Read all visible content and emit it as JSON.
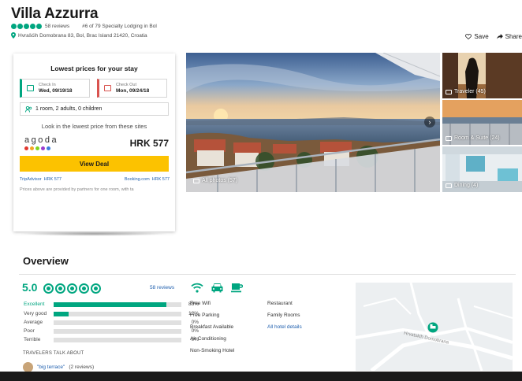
{
  "header": {
    "title": "Villa Azzurra",
    "reviews": "58 reviews",
    "ranking": "#6 of 79 Specialty Lodging in Bol",
    "address": "Hvrašćih Domobrana 83, Bol, Brac Island 21420, Croatia",
    "save_label": "Save",
    "share_label": "Share"
  },
  "pricing": {
    "title": "Lowest prices for your stay",
    "check_in_label": "Check In",
    "check_in_value": "Wed, 09/19/18",
    "check_out_label": "Check Out",
    "check_out_value": "Mon, 09/24/18",
    "guests": "1 room, 2 adults, 0 children",
    "look_text": "Look in the lowest price from these sites",
    "provider": "agoda",
    "price": "HRK 577",
    "deal_label": "View Deal",
    "partners": [
      {
        "name": "TripAdvisor",
        "price": "HRK 577"
      },
      {
        "name": "Booking.com",
        "price": "HRK 577"
      }
    ],
    "disclaimer": "Prices above are provided by partners for one room, with ta"
  },
  "photos": {
    "all_label": "All photos (57)",
    "side": [
      {
        "label": "Traveler (45)"
      },
      {
        "label": "Room & Suite (24)"
      },
      {
        "label": "Dining (4)"
      }
    ]
  },
  "overview": {
    "title": "Overview",
    "score": "5.0",
    "reviews_link": "58 reviews",
    "ratings": [
      {
        "label": "Excellent",
        "pct": "88%",
        "value": 88
      },
      {
        "label": "Very good",
        "pct": "12%",
        "value": 12
      },
      {
        "label": "Average",
        "pct": "0%",
        "value": 0
      },
      {
        "label": "Poor",
        "pct": "0%",
        "value": 0
      },
      {
        "label": "Terrible",
        "pct": "0%",
        "value": 0
      }
    ],
    "travelers_title": "TRAVELERS TALK ABOUT",
    "talk_link": "\"big terrace\"",
    "talk_count": "(2 reviews)",
    "amenities_left": [
      "Free Wifi",
      "Free Parking",
      "Breakfast Available",
      "Air Conditioning",
      "Non-Smoking Hotel"
    ],
    "amenities_right": [
      "Restaurant",
      "Family Rooms"
    ],
    "details_link": "All hotel details",
    "map_street": "Hrvatskih Domobrana"
  },
  "colors": {
    "brand_green": "#00a680",
    "deal_yellow": "#fcc200",
    "check_out_red": "#d9534f",
    "link_blue": "#1f5fae"
  }
}
